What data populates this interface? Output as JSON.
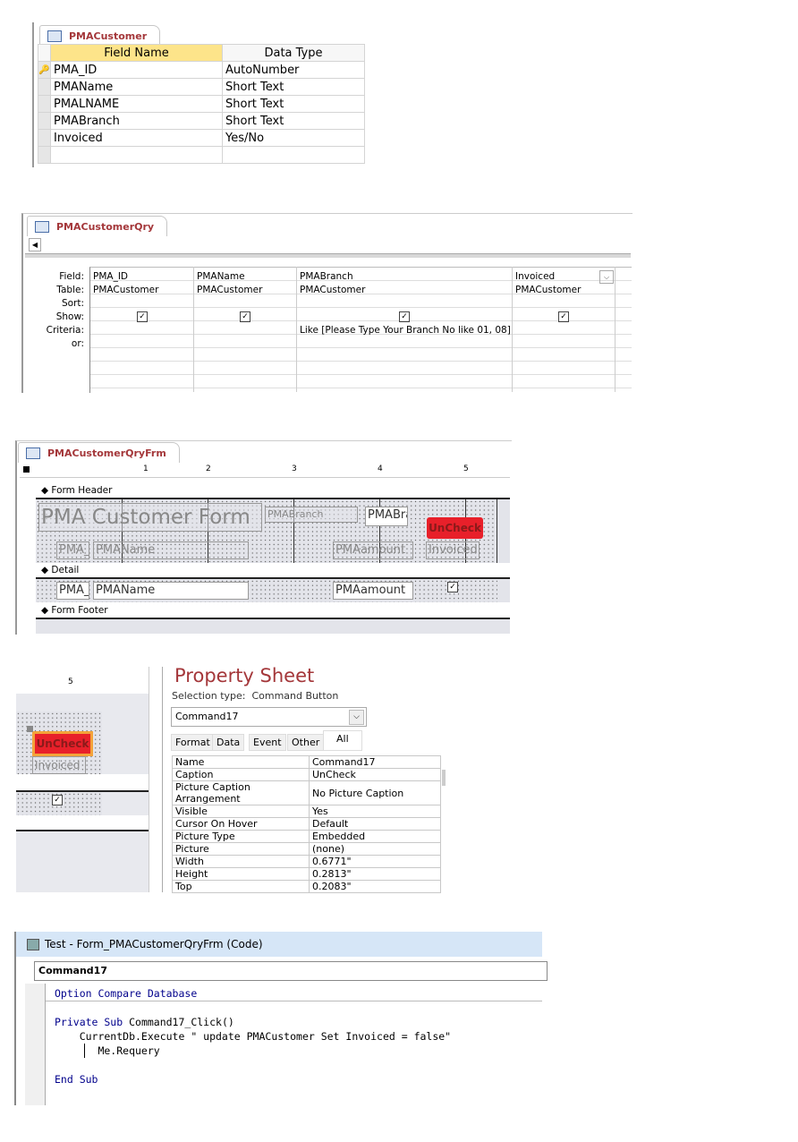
{
  "table_design": {
    "tab": "PMACustomer",
    "headers": [
      "Field Name",
      "Data Type"
    ],
    "rows": [
      {
        "field": "PMA_ID",
        "type": "AutoNumber",
        "key": true
      },
      {
        "field": "PMAName",
        "type": "Short Text"
      },
      {
        "field": "PMALNAME",
        "type": "Short Text"
      },
      {
        "field": "PMABranch",
        "type": "Short Text"
      },
      {
        "field": "Invoiced",
        "type": "Yes/No"
      },
      {
        "field": "",
        "type": ""
      }
    ]
  },
  "query": {
    "tab": "PMACustomerQry",
    "row_labels": [
      "Field:",
      "Table:",
      "Sort:",
      "Show:",
      "Criteria:",
      "or:"
    ],
    "columns": [
      {
        "field": "PMA_ID",
        "table": "PMACustomer",
        "show": true,
        "criteria": ""
      },
      {
        "field": "PMAName",
        "table": "PMACustomer",
        "show": true,
        "criteria": ""
      },
      {
        "field": "PMABranch",
        "table": "PMACustomer",
        "show": true,
        "criteria": "Like [Please Type Your Branch No like 01, 08]"
      },
      {
        "field": "Invoiced",
        "table": "PMACustomer",
        "show": true,
        "criteria": ""
      }
    ]
  },
  "form": {
    "tab": "PMACustomerQryFrm",
    "ruler": [
      "1",
      "2",
      "3",
      "4",
      "5"
    ],
    "sections": [
      "Form Header",
      "Detail",
      "Form Footer"
    ],
    "header": {
      "title": "PMA Customer Form",
      "branch_label": "PMABranch",
      "branch_box": "PMABra",
      "button": "UnCheck",
      "labels": [
        "PMA_",
        "PMAName",
        "PMAamount",
        "Invoiced"
      ]
    },
    "detail": {
      "fields": [
        "PMA_",
        "PMAName",
        "PMAamount"
      ],
      "checked": true
    },
    "button_color": "#e8202a"
  },
  "property_sheet": {
    "title": "Property Sheet",
    "selection_label": "Selection type:",
    "selection_type": "Command Button",
    "object": "Command17",
    "tabs": [
      "Format",
      "Data",
      "Event",
      "Other",
      "All"
    ],
    "active_tab": "All",
    "ruler_num": "5",
    "button": "UnCheck",
    "label": "Invoiced",
    "rows": [
      [
        "Name",
        "Command17"
      ],
      [
        "Caption",
        "UnCheck"
      ],
      [
        "Picture Caption Arrangement",
        "No Picture Caption"
      ],
      [
        "Visible",
        "Yes"
      ],
      [
        "Cursor On Hover",
        "Default"
      ],
      [
        "Picture Type",
        "Embedded"
      ],
      [
        "Picture",
        "(none)"
      ],
      [
        "Width",
        "0.6771\""
      ],
      [
        "Height",
        "0.2813\""
      ],
      [
        "Top",
        "0.2083\""
      ]
    ]
  },
  "code": {
    "title": "Test - Form_PMACustomerQryFrm (Code)",
    "object": "Command17",
    "l1a": "Option Compare Database",
    "l2a": "Private Sub",
    "l2b": " Command17_Click()",
    "l3": "    CurrentDb.Execute \" update PMACustomer Set Invoiced = false\"",
    "l4": "       Me.Requery",
    "l5": "End Sub"
  }
}
